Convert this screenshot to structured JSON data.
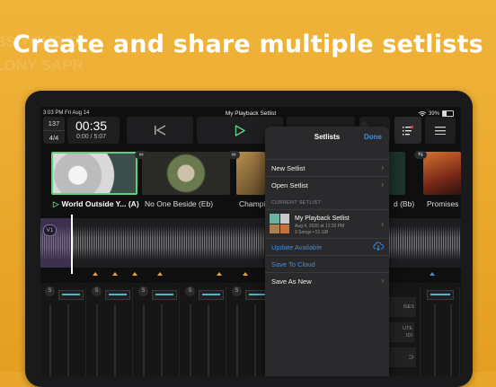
{
  "headline": "Create and share multiple setlists",
  "background_ghost": [
    "BS YOUR D",
    "LONY SAPR"
  ],
  "status_bar": {
    "time": "3:03 PM  Fri Aug 14",
    "title": "My Playback Setlist",
    "battery": "39%"
  },
  "transport": {
    "bpm": "137",
    "time_signature": "4/4",
    "elapsed_big": "00:35",
    "elapsed_detail": "0:00 / 5:07"
  },
  "icons": {
    "prev": "skip-back-icon",
    "play": "play-icon",
    "setlist": "setlist-icon",
    "menu": "hamburger-menu-icon",
    "link": "link-icon",
    "cloud": "cloud-download-icon"
  },
  "songs": [
    {
      "label": "World Outside Y... (A)",
      "active": true
    },
    {
      "label": "No One Beside (Eb)",
      "active": false
    },
    {
      "label": "Champi",
      "active": false
    },
    {
      "label": "d (Bb)",
      "active": false
    },
    {
      "label": "Promises (",
      "active": false
    }
  ],
  "waveform": {
    "version_badge": "V1",
    "progress_fraction": 0.073
  },
  "mixer": {
    "solo_label": "S",
    "channel_count": 8
  },
  "partial_labels": {
    "right_mixer_1": "ISES",
    "right_mixer_2": "UTE\nIDI"
  },
  "popover": {
    "title": "Setlists",
    "done": "Done",
    "items": [
      {
        "label": "New Setlist"
      },
      {
        "label": "Open Setlist"
      }
    ],
    "current_section": "CURRENT SETLIST",
    "current": {
      "name": "My Playback Setlist",
      "date": "Aug 4, 2020 at 12:33 PM",
      "details": "9 Songs • 51 GB"
    },
    "actions": [
      {
        "label": "Update Available",
        "style": "blue"
      },
      {
        "label": "Save To Cloud",
        "style": "blue"
      },
      {
        "label": "Save As New",
        "style": "white"
      }
    ]
  },
  "colors": {
    "accent_green": "#5ecf7c",
    "link_blue": "#3c8fe0",
    "background_orange": "#e8a72c",
    "marker_orange": "#e5a33a"
  }
}
